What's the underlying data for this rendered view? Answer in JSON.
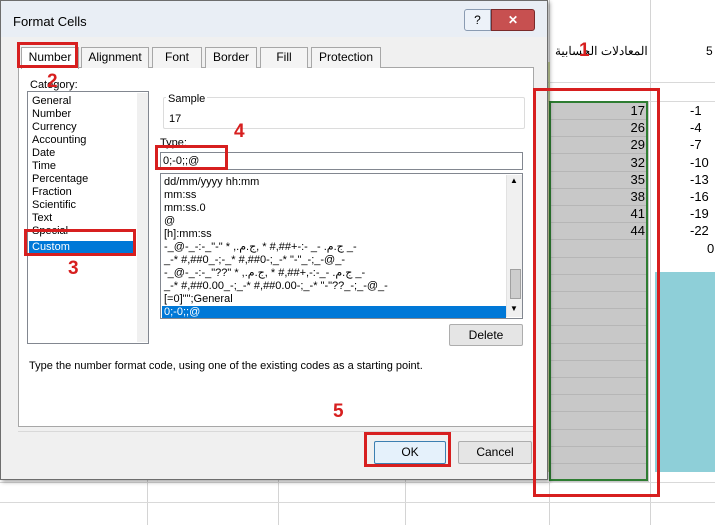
{
  "sheet": {
    "header_arabic": "المعادلات الحسابية",
    "header_right": "5",
    "values": [
      "17",
      "26",
      "29",
      "32",
      "35",
      "38",
      "41",
      "44"
    ],
    "right_values": [
      "-1",
      "-4",
      "-7",
      "-10",
      "-13",
      "-16",
      "-19",
      "-22",
      "0"
    ]
  },
  "dialog": {
    "title": "Format Cells",
    "help_label": "?",
    "close_label": "✕",
    "tabs": [
      "Number",
      "Alignment",
      "Font",
      "Border",
      "Fill",
      "Protection"
    ],
    "category_label": "Category:",
    "categories": [
      "General",
      "Number",
      "Currency",
      "Accounting",
      "Date",
      "Time",
      "Percentage",
      "Fraction",
      "Scientific",
      "Text",
      "Special",
      "Custom"
    ],
    "selected_category": "Custom",
    "sample_label": "Sample",
    "sample_value": "17",
    "type_label": "Type:",
    "type_value": "0;-0;;@",
    "formats": [
      "dd/mm/yyyy hh:mm",
      "mm:ss",
      "mm:ss.0",
      "@",
      "[h]:mm:ss",
      "-_@-_-:-_\"-\" * ,ج.م.‏ -_ -:-+##,# * ,ج.م.‏ _-",
      "_-* #,##0_-;-_* #,##0-;_-* \"-\"_-;_-@_-",
      "-_@-_-:-_\"??\" * ,ج.م.‏ -_-:-,+##,# * ,ج.م.‏ _-",
      "_-* #,##0.00_-;_-* #,##0.00-;_-* \"-\"??_-;_-@_-",
      "[=0]\"\";General",
      "0;-0;;@"
    ],
    "selected_format": "0;-0;;@",
    "delete_label": "Delete",
    "description": "Type the number format code, using one of the existing codes as a starting point.",
    "ok_label": "OK",
    "cancel_label": "Cancel"
  },
  "annotations": [
    "1",
    "2",
    "3",
    "4",
    "5"
  ],
  "colors": {
    "annotation": "#d71f1f",
    "selection": "#0078d7",
    "sheet_selection": "#2e7d32"
  }
}
